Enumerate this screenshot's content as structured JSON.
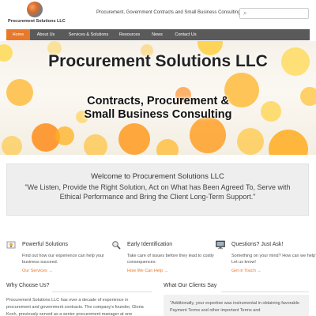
{
  "header": {
    "logo_text": "Procurement Solutions LLC",
    "tagline": "Procurement, Government Contracts and Small Business Consulting",
    "search_placeholder": ""
  },
  "nav": {
    "items": [
      {
        "label": "Home",
        "active": true
      },
      {
        "label": "About Us"
      },
      {
        "label": "Services & Solutions"
      },
      {
        "label": "Resources"
      },
      {
        "label": "News"
      },
      {
        "label": "Contact Us"
      }
    ]
  },
  "hero": {
    "title": "Procurement Solutions LLC",
    "subtitle_line1": "Contracts, Procurement &",
    "subtitle_line2": "Small Business Consulting"
  },
  "welcome": {
    "title": "Welcome to Procurement Solutions LLC",
    "quote": "\"We Listen, Provide the Right Solution, Act on What has Been Agreed To, Serve with Ethical Performance and Bring the Client Long-Term Support.\""
  },
  "features": [
    {
      "icon": "lightbulb-icon",
      "title": "Powerful Solutions",
      "desc": "Find out how our experience can help your business succeed.",
      "link": "Our Services →"
    },
    {
      "icon": "magnifier-icon",
      "title": "Early Identification",
      "desc": "Take care of issues before they lead to costly consequences.",
      "link": "How We Can Help →"
    },
    {
      "icon": "monitor-icon",
      "title": "Questions? Just Ask!",
      "desc": "Something on your mind? How can we help? Let us know!",
      "link": "Get in Touch →"
    }
  ],
  "why": {
    "title": "Why Choose Us?",
    "text": "Procurement Solutions LLC has over a decade of experience in procurement and government contracts. The company's founder, Gloria Koch, previously served as a senior procurement manager at one"
  },
  "clients": {
    "title": "What Our Clients Say",
    "quote": "\"Additionally, your expertise was instrumental in obtaining favorable Payment Terms and other important Terms and"
  },
  "colors": {
    "accent": "#e8782a",
    "nav_bg": "#5a5a5a"
  }
}
